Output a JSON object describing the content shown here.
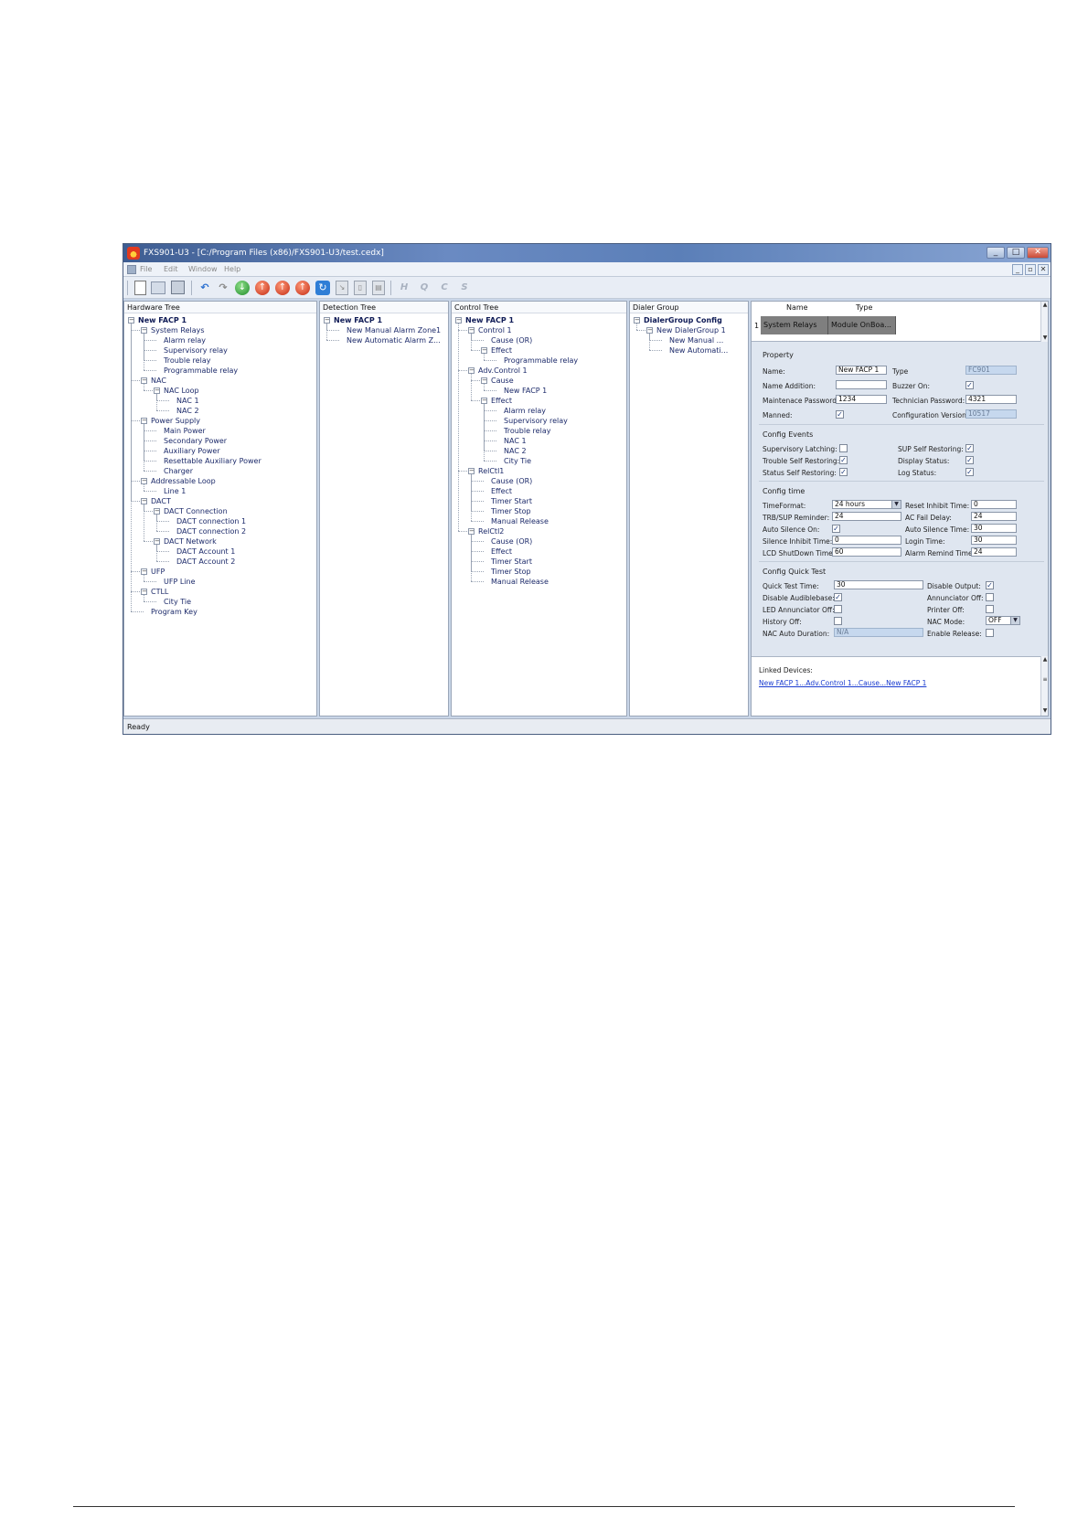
{
  "window": {
    "title": "FXS901-U3 - [C:/Program Files (x86)/FXS901-U3/test.cedx]",
    "min": "_",
    "max": "□",
    "close": "✕"
  },
  "menu": {
    "items": [
      "File",
      "Edit",
      "Window",
      "Help"
    ],
    "mdi": [
      "_",
      "▫",
      "✕"
    ]
  },
  "toolbar": {
    "letters": [
      "H",
      "Q",
      "C",
      "S"
    ]
  },
  "panes": {
    "hardware": {
      "title": "Hardware Tree",
      "nodes": [
        {
          "label": "New FACP 1",
          "depth": 0,
          "bold": true,
          "box": "⊟"
        },
        {
          "label": "System Relays",
          "depth": 1,
          "box": "⊟"
        },
        {
          "label": "Alarm relay",
          "depth": 2
        },
        {
          "label": "Supervisory relay",
          "depth": 2
        },
        {
          "label": "Trouble relay",
          "depth": 2
        },
        {
          "label": "Programmable relay",
          "depth": 2
        },
        {
          "label": "NAC",
          "depth": 1,
          "box": "⊟"
        },
        {
          "label": "NAC Loop",
          "depth": 2,
          "box": "⊟"
        },
        {
          "label": "NAC 1",
          "depth": 3
        },
        {
          "label": "NAC 2",
          "depth": 3
        },
        {
          "label": "Power Supply",
          "depth": 1,
          "box": "⊟"
        },
        {
          "label": "Main Power",
          "depth": 2
        },
        {
          "label": "Secondary Power",
          "depth": 2
        },
        {
          "label": "Auxiliary Power",
          "depth": 2
        },
        {
          "label": "Resettable Auxiliary Power",
          "depth": 2
        },
        {
          "label": "Charger",
          "depth": 2
        },
        {
          "label": "Addressable Loop",
          "depth": 1,
          "box": "⊟"
        },
        {
          "label": "Line 1",
          "depth": 2
        },
        {
          "label": "DACT",
          "depth": 1,
          "box": "⊟"
        },
        {
          "label": "DACT Connection",
          "depth": 2,
          "box": "⊟"
        },
        {
          "label": "DACT connection 1",
          "depth": 3
        },
        {
          "label": "DACT connection 2",
          "depth": 3
        },
        {
          "label": "DACT Network",
          "depth": 2,
          "box": "⊟"
        },
        {
          "label": "DACT Account 1",
          "depth": 3
        },
        {
          "label": "DACT Account 2",
          "depth": 3
        },
        {
          "label": "UFP",
          "depth": 1,
          "box": "⊟"
        },
        {
          "label": "UFP Line",
          "depth": 2
        },
        {
          "label": "CTLL",
          "depth": 1,
          "box": "⊟"
        },
        {
          "label": "City Tie",
          "depth": 2
        },
        {
          "label": "Program Key",
          "depth": 1
        }
      ]
    },
    "detection": {
      "title": "Detection Tree",
      "nodes": [
        {
          "label": "New FACP 1",
          "depth": 0,
          "bold": true,
          "box": "⊟"
        },
        {
          "label": "New Manual Alarm Zone1",
          "depth": 1
        },
        {
          "label": "New Automatic Alarm Z...",
          "depth": 1
        }
      ]
    },
    "control": {
      "title": "Control Tree",
      "nodes": [
        {
          "label": "New FACP 1",
          "depth": 0,
          "bold": true,
          "box": "⊟"
        },
        {
          "label": "Control 1",
          "depth": 1,
          "box": "⊟"
        },
        {
          "label": "Cause (OR)",
          "depth": 2
        },
        {
          "label": "Effect",
          "depth": 2,
          "box": "⊟"
        },
        {
          "label": "Programmable relay",
          "depth": 3
        },
        {
          "label": "Adv.Control 1",
          "depth": 1,
          "box": "⊟"
        },
        {
          "label": "Cause",
          "depth": 2,
          "box": "⊟"
        },
        {
          "label": "New FACP 1",
          "depth": 3
        },
        {
          "label": "Effect",
          "depth": 2,
          "box": "⊟"
        },
        {
          "label": "Alarm relay",
          "depth": 3
        },
        {
          "label": "Supervisory relay",
          "depth": 3
        },
        {
          "label": "Trouble relay",
          "depth": 3
        },
        {
          "label": "NAC 1",
          "depth": 3
        },
        {
          "label": "NAC 2",
          "depth": 3
        },
        {
          "label": "City Tie",
          "depth": 3
        },
        {
          "label": "RelCtl1",
          "depth": 1,
          "box": "⊟"
        },
        {
          "label": "Cause (OR)",
          "depth": 2
        },
        {
          "label": "Effect",
          "depth": 2
        },
        {
          "label": "Timer Start",
          "depth": 2
        },
        {
          "label": "Timer Stop",
          "depth": 2
        },
        {
          "label": "Manual Release",
          "depth": 2
        },
        {
          "label": "RelCtl2",
          "depth": 1,
          "box": "⊟"
        },
        {
          "label": "Cause (OR)",
          "depth": 2
        },
        {
          "label": "Effect",
          "depth": 2
        },
        {
          "label": "Timer Start",
          "depth": 2
        },
        {
          "label": "Timer Stop",
          "depth": 2
        },
        {
          "label": "Manual Release",
          "depth": 2
        }
      ]
    },
    "dialer": {
      "title": "Dialer Group",
      "nodes": [
        {
          "label": "DialerGroup Config",
          "depth": 0,
          "bold": true,
          "box": "⊟"
        },
        {
          "label": "New DialerGroup 1",
          "depth": 1,
          "box": "⊟"
        },
        {
          "label": "New Manual ...",
          "depth": 2
        },
        {
          "label": "New Automati...",
          "depth": 2
        }
      ]
    }
  },
  "grid": {
    "headers": [
      "Name",
      "Type"
    ],
    "row_number": "1",
    "row": [
      "System Relays",
      "Module OnBoa..."
    ]
  },
  "property": {
    "title": "Property",
    "name_label": "Name:",
    "name_value": "New FACP 1",
    "type_label": "Type",
    "type_value": "FC901",
    "name_addition_label": "Name Addition:",
    "name_addition_value": "",
    "buzzer_label": "Buzzer On:",
    "buzzer_check": "✓",
    "maint_pw_label": "Maintenace Password:",
    "maint_pw_value": "1234",
    "tech_pw_label": "Technician Password:",
    "tech_pw_value": "4321",
    "manned_label": "Manned:",
    "manned_check": "✓",
    "config_ver_label": "Configuration Version:",
    "config_ver_value": "10517"
  },
  "events": {
    "title": "Config Events",
    "sup_latch_label": "Supervisory Latching:",
    "sup_latch_check": "",
    "sup_self_label": "SUP Self Restoring:",
    "sup_self_check": "✓",
    "trouble_self_label": "Trouble Self Restoring:",
    "trouble_self_check": "✓",
    "display_status_label": "Display Status:",
    "display_status_check": "✓",
    "status_self_label": "Status Self Restoring:",
    "status_self_check": "✓",
    "log_status_label": "Log Status:",
    "log_status_check": "✓"
  },
  "time": {
    "title": "Config time",
    "timeformat_label": "TimeFormat:",
    "timeformat_value": "24 hours",
    "reset_inhibit_label": "Reset Inhibit Time:",
    "reset_inhibit_value": "0",
    "trb_sup_label": "TRB/SUP Reminder:",
    "trb_sup_value": "24",
    "ac_fail_label": "AC Fail Delay:",
    "ac_fail_value": "24",
    "auto_silence_on_label": "Auto Silence On:",
    "auto_silence_on_check": "✓",
    "auto_silence_time_label": "Auto Silence Time:",
    "auto_silence_time_value": "30",
    "silence_inhibit_label": "Silence Inhibit Time:",
    "silence_inhibit_value": "0",
    "login_time_label": "Login Time:",
    "login_time_value": "30",
    "lcd_shutdown_label": "LCD ShutDown Time:",
    "lcd_shutdown_value": "60",
    "alarm_remind_label": "Alarm Remind Time:",
    "alarm_remind_value": "24"
  },
  "quicktest": {
    "title": "Config Quick Test",
    "quick_test_label": "Quick Test Time:",
    "quick_test_value": "30",
    "disable_output_label": "Disable Output:",
    "disable_output_check": "✓",
    "disable_audible_label": "Disable Audiblebase:",
    "disable_audible_check": "✓",
    "annunciator_off_label": "Annunciator Off:",
    "annunciator_off_check": "",
    "led_annunciator_label": "LED Annunciator Off:",
    "led_annunciator_check": "",
    "printer_off_label": "Printer Off:",
    "printer_off_check": "",
    "history_off_label": "History Off:",
    "history_off_check": "",
    "nac_mode_label": "NAC Mode:",
    "nac_mode_value": "OFF",
    "nac_auto_label": "NAC Auto Duration:",
    "nac_auto_value": "N/A",
    "enable_release_label": "Enable Release:",
    "enable_release_check": ""
  },
  "linked": {
    "label": "Linked Devices:",
    "link": "New FACP 1...Adv.Control 1...Cause...New FACP 1"
  },
  "status": {
    "text": "Ready"
  }
}
